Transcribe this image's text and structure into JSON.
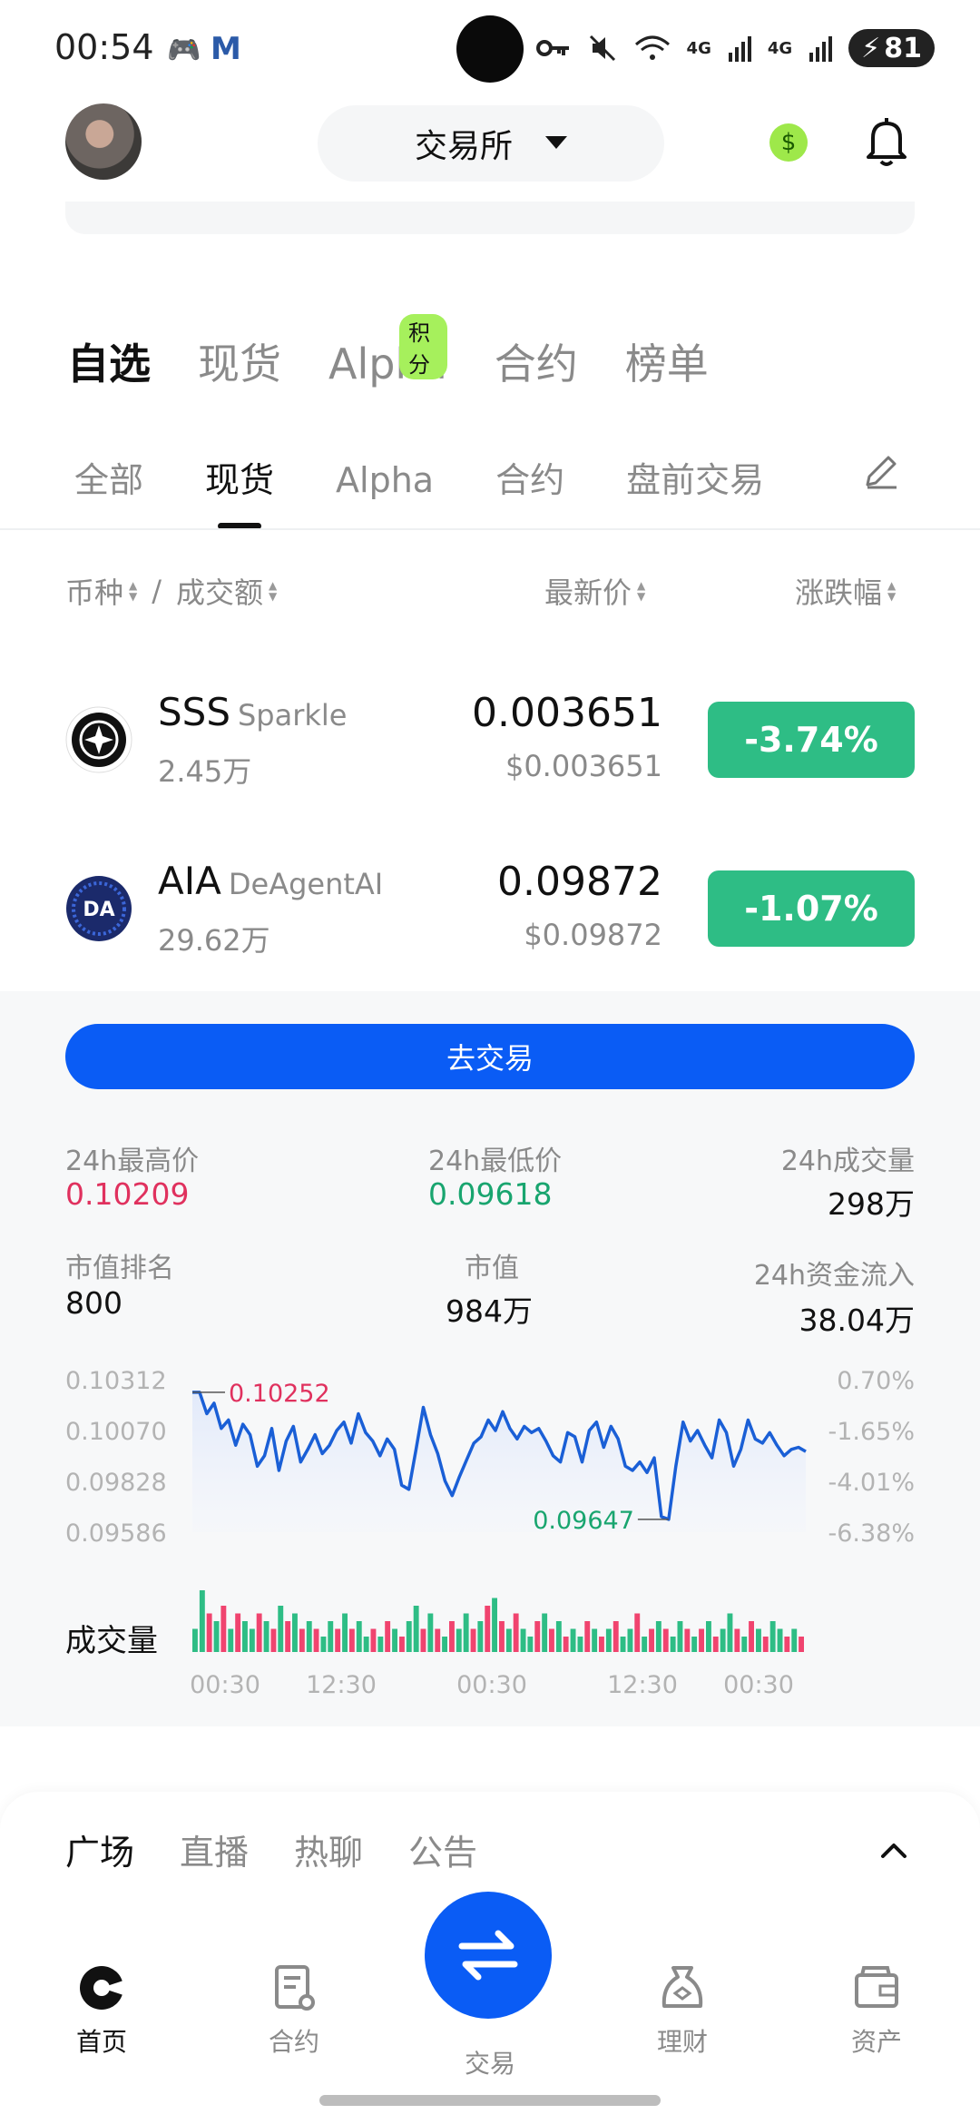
{
  "status": {
    "time": "00:54",
    "battery": "81",
    "net1": "4G",
    "net2": "4G"
  },
  "header": {
    "exchange_label": "交易所"
  },
  "main_tabs": [
    {
      "label": "自选",
      "active": true
    },
    {
      "label": "现货"
    },
    {
      "label": "Alpha",
      "badge": "积分"
    },
    {
      "label": "合约"
    },
    {
      "label": "榜单"
    }
  ],
  "sub_tabs": [
    {
      "label": "全部"
    },
    {
      "label": "现货",
      "active": true
    },
    {
      "label": "Alpha"
    },
    {
      "label": "合约"
    },
    {
      "label": "盘前交易"
    }
  ],
  "columns": {
    "coin": "币种",
    "sep": "/",
    "turnover": "成交额",
    "price": "最新价",
    "change": "涨跌幅"
  },
  "rows": [
    {
      "symbol": "SSS",
      "name": "Sparkle",
      "volume": "2.45万",
      "price": "0.003651",
      "price_usd": "$0.003651",
      "change": "-3.74%"
    },
    {
      "symbol": "AIA",
      "name": "DeAgentAI",
      "volume": "29.62万",
      "price": "0.09872",
      "price_usd": "$0.09872",
      "change": "-1.07%"
    }
  ],
  "detail": {
    "trade_button": "去交易",
    "high_label": "24h最高价",
    "high_value": "0.10209",
    "low_label": "24h最低价",
    "low_value": "0.09618",
    "vol_label": "24h成交量",
    "vol_value": "298万",
    "rank_label": "市值排名",
    "rank_value": "800",
    "mcap_label": "市值",
    "mcap_value": "984万",
    "inflow_label": "24h资金流入",
    "inflow_value": "38.04万",
    "volume_title": "成交量"
  },
  "chart_data": {
    "type": "line",
    "y_ticks": [
      "0.10312",
      "0.10070",
      "0.09828",
      "0.09586"
    ],
    "pct_ticks": [
      "0.70%",
      "-1.65%",
      "-4.01%",
      "-6.38%"
    ],
    "x_ticks": [
      "00:30",
      "12:30",
      "00:30",
      "12:30",
      "00:30"
    ],
    "ylim": [
      0.09586,
      0.10312
    ],
    "max_label": "0.10252",
    "min_label": "0.09647",
    "line_color": "#1a5fd6",
    "values": [
      0.10252,
      0.10252,
      0.1015,
      0.102,
      0.1008,
      0.1012,
      0.1,
      0.101,
      0.1005,
      0.099,
      0.0995,
      0.1008,
      0.0988,
      0.1002,
      0.1009,
      0.0992,
      0.0998,
      0.1005,
      0.0996,
      0.1,
      0.1007,
      0.1011,
      0.1001,
      0.1015,
      0.1006,
      0.1002,
      0.0995,
      0.1003,
      0.0998,
      0.0981,
      0.0979,
      0.0998,
      0.1018,
      0.1005,
      0.0996,
      0.0983,
      0.0976,
      0.0985,
      0.0993,
      0.1001,
      0.1004,
      0.1012,
      0.1007,
      0.1016,
      0.1008,
      0.1003,
      0.1009,
      0.1006,
      0.1008,
      0.1002,
      0.0995,
      0.0992,
      0.1006,
      0.1004,
      0.0992,
      0.1007,
      0.1011,
      0.0999,
      0.1009,
      0.1003,
      0.099,
      0.0988,
      0.0992,
      0.0987,
      0.0994,
      0.0966,
      0.09647,
      0.099,
      0.1011,
      0.1002,
      0.1007,
      0.1,
      0.0994,
      0.1012,
      0.1006,
      0.099,
      0.0998,
      0.1012,
      0.1003,
      0.1001,
      0.1006,
      0.1,
      0.0995,
      0.0998,
      0.0999,
      0.0997
    ],
    "volume_values": [
      3,
      8,
      5,
      4,
      6,
      3,
      5,
      4,
      3,
      5,
      4,
      3,
      6,
      4,
      5,
      3,
      4,
      3,
      2,
      4,
      3,
      5,
      3,
      4,
      2,
      3,
      2,
      4,
      3,
      2,
      4,
      6,
      3,
      5,
      3,
      2,
      4,
      3,
      5,
      3,
      4,
      6,
      7,
      4,
      3,
      5,
      3,
      2,
      4,
      5,
      3,
      4,
      2,
      3,
      2,
      4,
      3,
      2,
      3,
      4,
      2,
      3,
      5,
      2,
      3,
      4,
      3,
      2,
      4,
      3,
      2,
      3,
      4,
      2,
      3,
      5,
      3,
      2,
      4,
      3,
      2,
      4,
      3,
      2,
      3,
      2
    ],
    "volume_up": [
      true,
      true,
      false,
      true,
      false,
      true,
      false,
      true,
      true,
      false,
      true,
      false,
      true,
      false,
      true,
      false,
      true,
      false,
      true,
      true,
      false,
      true,
      false,
      true,
      true,
      false,
      true,
      false,
      true,
      false,
      true,
      true,
      false,
      true,
      false,
      true,
      false,
      true,
      true,
      false,
      true,
      false,
      true,
      false,
      true,
      false,
      true,
      true,
      false,
      true,
      false,
      true,
      false,
      true,
      true,
      false,
      true,
      false,
      true,
      false,
      true,
      true,
      false,
      true,
      false,
      true,
      false,
      true,
      true,
      false,
      true,
      false,
      true,
      false,
      true,
      true,
      false,
      true,
      false,
      true,
      false,
      true,
      true,
      false,
      true,
      false
    ]
  },
  "community": {
    "tabs": [
      "广场",
      "直播",
      "热聊",
      "公告"
    ]
  },
  "nav": [
    {
      "label": "首页",
      "active": true
    },
    {
      "label": "合约"
    },
    {
      "label": "交易"
    },
    {
      "label": "理财"
    },
    {
      "label": "资产"
    }
  ]
}
